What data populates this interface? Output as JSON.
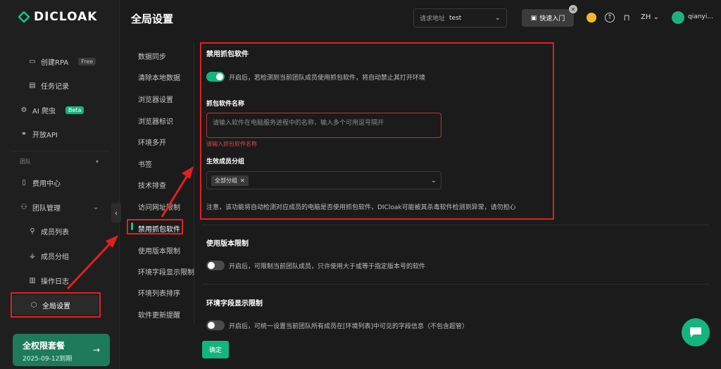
{
  "app": {
    "logo_text": "DICLOAK",
    "page_title": "全局设置"
  },
  "header": {
    "address_label": "请求地址",
    "address_value": "test",
    "quick_start": "快速入门",
    "lang": "ZH",
    "username": "qianyi..."
  },
  "sidebar": {
    "items": [
      {
        "label": "创建RPA",
        "badge": "Free"
      },
      {
        "label": "任务记录"
      },
      {
        "label": "AI 爬虫",
        "badge": "Beta"
      },
      {
        "label": "开放API"
      },
      {
        "label": "团队"
      },
      {
        "label": "费用中心"
      },
      {
        "label": "团队管理"
      },
      {
        "label": "成员列表"
      },
      {
        "label": "成员分组"
      },
      {
        "label": "操作日志"
      },
      {
        "label": "全局设置"
      }
    ],
    "promo": {
      "title": "全权限套餐",
      "expiry": "2025-09-12到期"
    }
  },
  "sub_nav": {
    "items": [
      "数据同步",
      "清除本地数据",
      "浏览器设置",
      "浏览器标识",
      "环境多开",
      "书签",
      "技术排查",
      "访问网址限制",
      "禁用抓包软件",
      "使用版本限制",
      "环境字段显示限制",
      "环境列表排序",
      "软件更新提醒"
    ]
  },
  "content": {
    "capture": {
      "title": "禁用抓包软件",
      "toggle_desc": "开启后，若检测到当前团队成员使用抓包软件，将自动禁止其打开环境",
      "name_label": "抓包软件名称",
      "name_placeholder": "请输入软件在电脑服务进程中的名称，输入多个可用逗号隔开",
      "name_error": "请输入抓包软件名称",
      "group_label": "生效成员分组",
      "group_tag": "全部分组",
      "notice": "注意，该功能将自动检测对应成员的电脑是否使用抓包软件，DICloak可能被其杀毒软件检测到异常，请勿担心"
    },
    "version": {
      "title": "使用版本限制",
      "toggle_desc": "开启后，可限制当前团队成员，只许使用大于或等于指定版本号的软件"
    },
    "field": {
      "title": "环境字段显示限制",
      "toggle_desc": "开启后，可统一设置当前团队所有成员在[环境列表]中可见的字段信息（不包含超管）"
    },
    "confirm": "确定"
  },
  "colors": {
    "accent": "#14b47f",
    "highlight": "#e0201f",
    "background": "#1b1b1b"
  }
}
